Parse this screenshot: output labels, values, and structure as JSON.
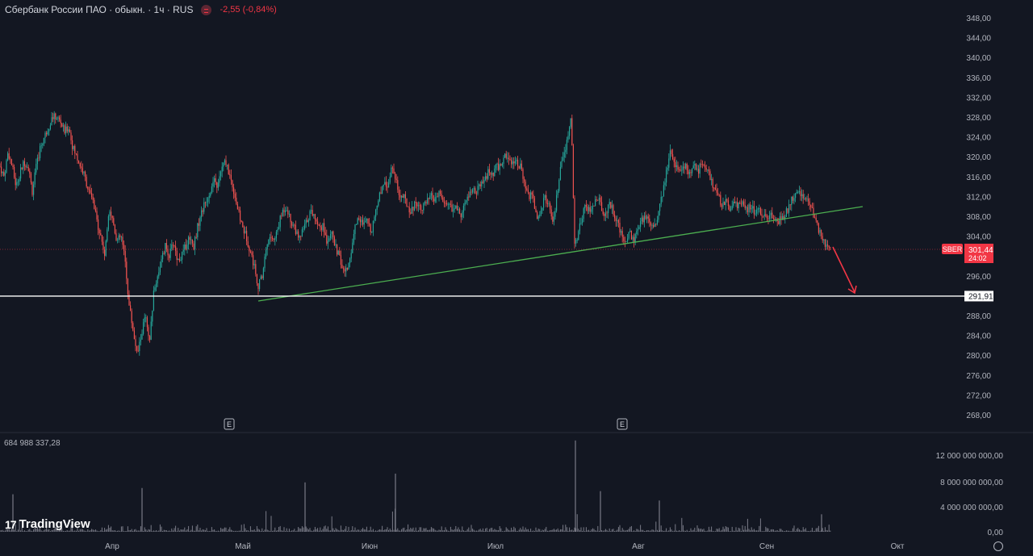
{
  "header": {
    "title": "Сбербанк России ПАО · обыкн. · 1ч · RUS",
    "change": "-2,55 (-0,84%)"
  },
  "volume_label": "684 988 337,28",
  "logo_text": "TradingView",
  "colors": {
    "background": "#131722",
    "up": "#26a69a",
    "down": "#ef5350",
    "trendline": "#4caf50",
    "support_line": "#ffffff",
    "arrow": "#f23645",
    "price_badge": "#f23645",
    "volume": "#787b86"
  },
  "chart_data": {
    "type": "candlestick",
    "ticker_label": "SBER",
    "current_price": "301,44",
    "countdown": "24:02",
    "support_label": "291,91",
    "support_value": 291.91,
    "y_ticks": [
      "348,00",
      "344,00",
      "340,00",
      "336,00",
      "332,00",
      "328,00",
      "324,00",
      "320,00",
      "316,00",
      "312,00",
      "308,00",
      "304,00",
      "300,00",
      "296,00",
      "292,00",
      "288,00",
      "284,00",
      "280,00",
      "276,00",
      "272,00",
      "268,00"
    ],
    "ylim": [
      266,
      352
    ],
    "x_ticks": [
      "Апр",
      "Май",
      "Июн",
      "Июл",
      "Авг",
      "Сен",
      "Окт"
    ],
    "volume_ticks": [
      "12 000 000 000,00",
      "8 000 000 000,00",
      "4 000 000 000,00",
      "0,00"
    ],
    "event_markers": [
      "E",
      "E"
    ],
    "price_path": [
      [
        0,
        318
      ],
      [
        5,
        316
      ],
      [
        10,
        321
      ],
      [
        15,
        318
      ],
      [
        20,
        314
      ],
      [
        25,
        317
      ],
      [
        30,
        319
      ],
      [
        35,
        318
      ],
      [
        40,
        313
      ],
      [
        45,
        318
      ],
      [
        50,
        322
      ],
      [
        55,
        324
      ],
      [
        60,
        326
      ],
      [
        65,
        328
      ],
      [
        70,
        328
      ],
      [
        75,
        327
      ],
      [
        80,
        325
      ],
      [
        85,
        326
      ],
      [
        90,
        322
      ],
      [
        95,
        320
      ],
      [
        100,
        318
      ],
      [
        105,
        316
      ],
      [
        110,
        313
      ],
      [
        115,
        311
      ],
      [
        120,
        307
      ],
      [
        125,
        304
      ],
      [
        130,
        300
      ],
      [
        135,
        310
      ],
      [
        140,
        307
      ],
      [
        145,
        303
      ],
      [
        150,
        304
      ],
      [
        155,
        299
      ],
      [
        160,
        290
      ],
      [
        165,
        285
      ],
      [
        170,
        280
      ],
      [
        175,
        284
      ],
      [
        180,
        288
      ],
      [
        185,
        282
      ],
      [
        190,
        292
      ],
      [
        195,
        296
      ],
      [
        200,
        299
      ],
      [
        205,
        302
      ],
      [
        210,
        300
      ],
      [
        215,
        303
      ],
      [
        220,
        299
      ],
      [
        225,
        300
      ],
      [
        230,
        302
      ],
      [
        235,
        304
      ],
      [
        240,
        302
      ],
      [
        245,
        306
      ],
      [
        250,
        309
      ],
      [
        255,
        311
      ],
      [
        260,
        313
      ],
      [
        265,
        315
      ],
      [
        270,
        314
      ],
      [
        275,
        318
      ],
      [
        280,
        319
      ],
      [
        285,
        316
      ],
      [
        290,
        313
      ],
      [
        295,
        309
      ],
      [
        300,
        306
      ],
      [
        305,
        304
      ],
      [
        310,
        301
      ],
      [
        315,
        298
      ],
      [
        320,
        294
      ],
      [
        325,
        296
      ],
      [
        330,
        302
      ],
      [
        335,
        304
      ],
      [
        340,
        303
      ],
      [
        345,
        306
      ],
      [
        350,
        309
      ],
      [
        355,
        310
      ],
      [
        360,
        307
      ],
      [
        365,
        306
      ],
      [
        370,
        303
      ],
      [
        375,
        305
      ],
      [
        380,
        307
      ],
      [
        385,
        309
      ],
      [
        390,
        308
      ],
      [
        395,
        306
      ],
      [
        400,
        306
      ],
      [
        405,
        303
      ],
      [
        410,
        305
      ],
      [
        415,
        302
      ],
      [
        420,
        300
      ],
      [
        425,
        297
      ],
      [
        430,
        297
      ],
      [
        435,
        301
      ],
      [
        440,
        306
      ],
      [
        445,
        308
      ],
      [
        450,
        306
      ],
      [
        455,
        307
      ],
      [
        460,
        305
      ],
      [
        465,
        309
      ],
      [
        470,
        312
      ],
      [
        475,
        315
      ],
      [
        480,
        314
      ],
      [
        485,
        318
      ],
      [
        490,
        316
      ],
      [
        495,
        312
      ],
      [
        500,
        312
      ],
      [
        505,
        310
      ],
      [
        510,
        309
      ],
      [
        515,
        311
      ],
      [
        520,
        310
      ],
      [
        525,
        310
      ],
      [
        530,
        311
      ],
      [
        535,
        312
      ],
      [
        540,
        311
      ],
      [
        545,
        313
      ],
      [
        550,
        310
      ],
      [
        555,
        311
      ],
      [
        560,
        309
      ],
      [
        565,
        310
      ],
      [
        570,
        308
      ],
      [
        575,
        310
      ],
      [
        580,
        312
      ],
      [
        585,
        313
      ],
      [
        590,
        313
      ],
      [
        595,
        314
      ],
      [
        600,
        315
      ],
      [
        605,
        317
      ],
      [
        610,
        316
      ],
      [
        615,
        318
      ],
      [
        620,
        318
      ],
      [
        625,
        320
      ],
      [
        630,
        320
      ],
      [
        635,
        319
      ],
      [
        640,
        319
      ],
      [
        645,
        318
      ],
      [
        650,
        314
      ],
      [
        655,
        312
      ],
      [
        660,
        312
      ],
      [
        665,
        308
      ],
      [
        670,
        309
      ],
      [
        675,
        312
      ],
      [
        680,
        310
      ],
      [
        685,
        306
      ],
      [
        690,
        312
      ],
      [
        695,
        318
      ],
      [
        700,
        321
      ],
      [
        705,
        325
      ],
      [
        708,
        328
      ],
      [
        712,
        302
      ],
      [
        716,
        304
      ],
      [
        720,
        307
      ],
      [
        725,
        311
      ],
      [
        730,
        309
      ],
      [
        735,
        310
      ],
      [
        740,
        312
      ],
      [
        745,
        310
      ],
      [
        750,
        308
      ],
      [
        755,
        311
      ],
      [
        760,
        309
      ],
      [
        765,
        307
      ],
      [
        770,
        304
      ],
      [
        775,
        303
      ],
      [
        780,
        305
      ],
      [
        785,
        303
      ],
      [
        790,
        305
      ],
      [
        795,
        307
      ],
      [
        800,
        308
      ],
      [
        805,
        307
      ],
      [
        810,
        306
      ],
      [
        815,
        308
      ],
      [
        820,
        312
      ],
      [
        825,
        316
      ],
      [
        830,
        321
      ],
      [
        835,
        319
      ],
      [
        840,
        318
      ],
      [
        845,
        317
      ],
      [
        850,
        318
      ],
      [
        855,
        316
      ],
      [
        860,
        318
      ],
      [
        865,
        317
      ],
      [
        870,
        319
      ],
      [
        875,
        318
      ],
      [
        880,
        316
      ],
      [
        885,
        313
      ],
      [
        890,
        312
      ],
      [
        895,
        310
      ],
      [
        900,
        311
      ],
      [
        905,
        309
      ],
      [
        910,
        311
      ],
      [
        915,
        310
      ],
      [
        920,
        311
      ],
      [
        925,
        309
      ],
      [
        930,
        310
      ],
      [
        935,
        309
      ],
      [
        940,
        309
      ],
      [
        945,
        308
      ],
      [
        950,
        308
      ],
      [
        955,
        308
      ],
      [
        960,
        307
      ],
      [
        965,
        307
      ],
      [
        970,
        308
      ],
      [
        975,
        309
      ],
      [
        980,
        311
      ],
      [
        985,
        312
      ],
      [
        990,
        313
      ],
      [
        995,
        312
      ],
      [
        1000,
        311
      ],
      [
        1005,
        310
      ],
      [
        1010,
        307
      ],
      [
        1015,
        305
      ],
      [
        1020,
        303
      ],
      [
        1025,
        302
      ],
      [
        1029,
        301.44
      ]
    ]
  }
}
